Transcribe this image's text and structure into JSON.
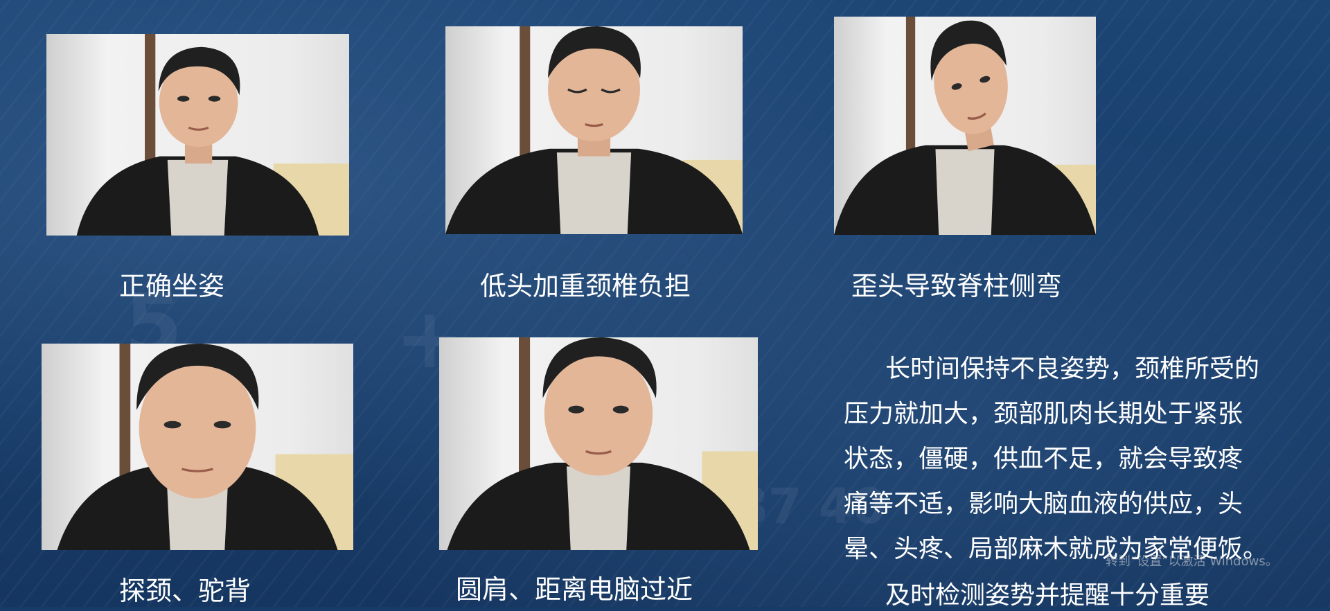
{
  "photos": [
    {
      "caption": "正确坐姿",
      "pose": "upright"
    },
    {
      "caption": "低头加重颈椎负担",
      "pose": "head-down"
    },
    {
      "caption": "歪头导致脊柱侧弯",
      "pose": "head-tilt"
    },
    {
      "caption": "探颈、驼背",
      "pose": "forward-neck"
    },
    {
      "caption": "圆肩、距离电脑过近",
      "pose": "too-close"
    }
  ],
  "paragraph": {
    "lines": [
      "长时间保持不良姿势，颈椎所受的",
      "压力就加大，颈部肌肉长期处于紧张",
      "状态，僵硬，供血不足，就会导致疼",
      "痛等不适，影响大脑血液的供应，头",
      "晕、头疼、局部麻木就成为家常便饭。"
    ],
    "conclusion": "及时检测姿势并提醒十分重要"
  },
  "watermark": "转到“设置”以激活 Windows。",
  "colors": {
    "background": "#173a67",
    "text": "#ffffff"
  }
}
